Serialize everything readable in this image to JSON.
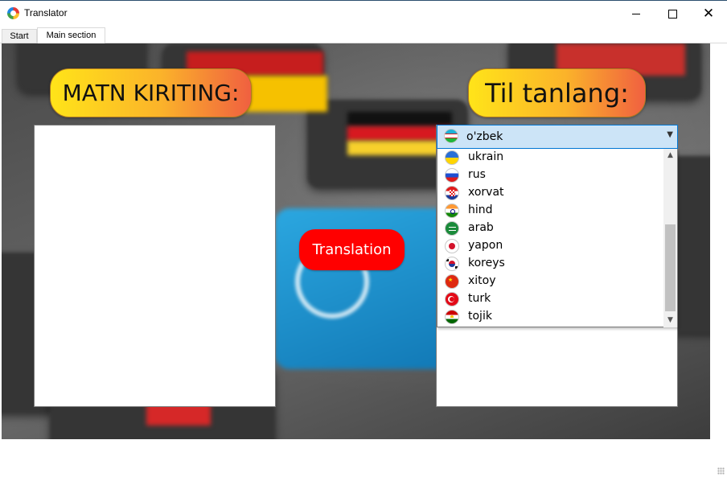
{
  "window": {
    "title": "Translator",
    "controls": {
      "minimize": "—",
      "maximize": "□",
      "close": "✕"
    }
  },
  "tabs": [
    {
      "label": "Start",
      "active": false
    },
    {
      "label": "Main section",
      "active": true
    }
  ],
  "main": {
    "input_heading": "MATN KIRITING:",
    "language_heading": "Til tanlang:",
    "translate_button": "Translation",
    "language_select": {
      "selected": "o'zbek",
      "selected_flag": "uzbekistan-flag-icon",
      "options": [
        {
          "label": "ukrain",
          "icon": "ukraine-flag-icon"
        },
        {
          "label": "rus",
          "icon": "russia-flag-icon"
        },
        {
          "label": "xorvat",
          "icon": "croatia-flag-icon"
        },
        {
          "label": "hind",
          "icon": "india-flag-icon"
        },
        {
          "label": "arab",
          "icon": "saudi-arabia-flag-icon"
        },
        {
          "label": "yapon",
          "icon": "japan-flag-icon"
        },
        {
          "label": "koreys",
          "icon": "south-korea-flag-icon"
        },
        {
          "label": "xitoy",
          "icon": "china-flag-icon"
        },
        {
          "label": "turk",
          "icon": "turkey-flag-icon"
        },
        {
          "label": "tojik",
          "icon": "tajikistan-flag-icon"
        }
      ],
      "scroll_position": 0.6
    }
  },
  "colors": {
    "accent": "#0078d7",
    "heading_gradient": [
      "#ffe419",
      "#fbb32a",
      "#f06040"
    ],
    "translate_button": "#ff0000"
  }
}
